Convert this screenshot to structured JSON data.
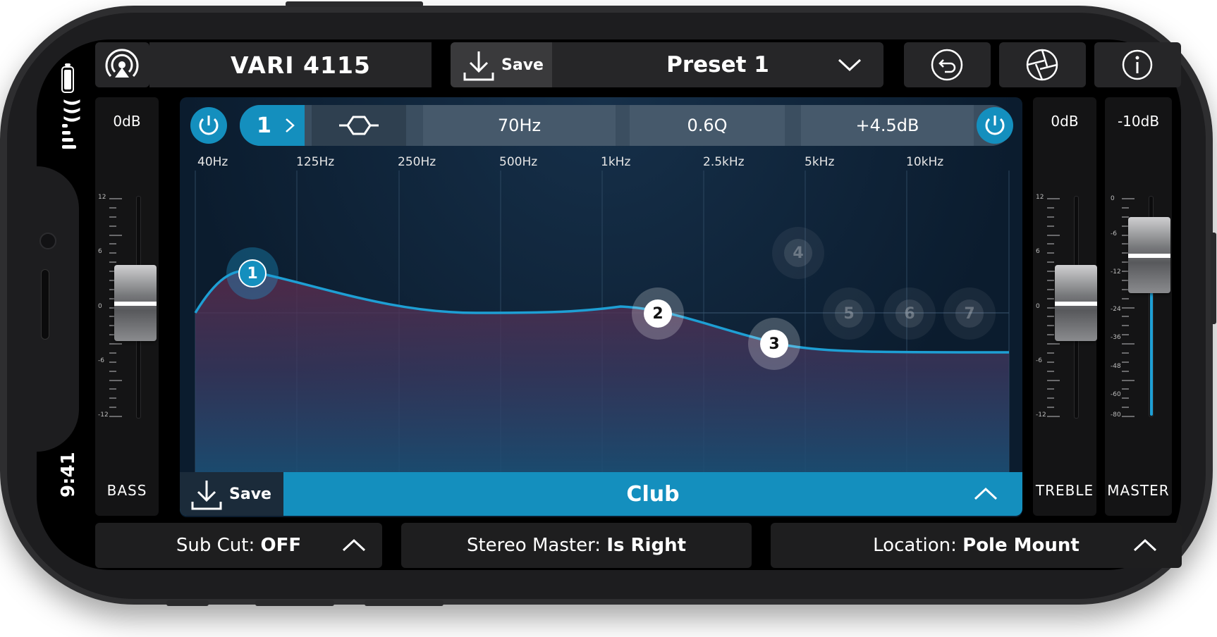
{
  "device": {
    "time": "9:41"
  },
  "header": {
    "device_name": "VARI 4115",
    "save_label": "Save",
    "preset_name": "Preset 1"
  },
  "band_bar": {
    "band_number": "1",
    "frequency": "70Hz",
    "q": "0.6Q",
    "gain": "+4.5dB"
  },
  "freq_axis": [
    "40Hz",
    "125Hz",
    "250Hz",
    "500Hz",
    "1kHz",
    "2.5kHz",
    "5kHz",
    "10kHz"
  ],
  "eq_nodes": [
    "1",
    "2",
    "3",
    "4",
    "5",
    "6",
    "7"
  ],
  "bass": {
    "value": "0dB",
    "label": "BASS",
    "ticks": [
      "12",
      "6",
      "0",
      "-6",
      "-12"
    ]
  },
  "treble": {
    "value": "0dB",
    "label": "TREBLE",
    "ticks": [
      "12",
      "6",
      "0",
      "-6",
      "-12"
    ]
  },
  "master": {
    "value": "-10dB",
    "label": "MASTER",
    "ticks": [
      "0",
      "-6",
      "-12",
      "-24",
      "-36",
      "-48",
      "-60",
      "-80"
    ]
  },
  "eq_footer": {
    "save_label": "Save",
    "preset_name": "Club"
  },
  "bottom": {
    "sub_cut_label": "Sub Cut: ",
    "sub_cut_value": "OFF",
    "stereo_label": "Stereo Master: ",
    "stereo_value": "Is Right",
    "location_label": "Location: ",
    "location_value": "Pole Mount"
  },
  "colors": {
    "accent": "#148fbe",
    "curve": "#1e9fd4"
  }
}
